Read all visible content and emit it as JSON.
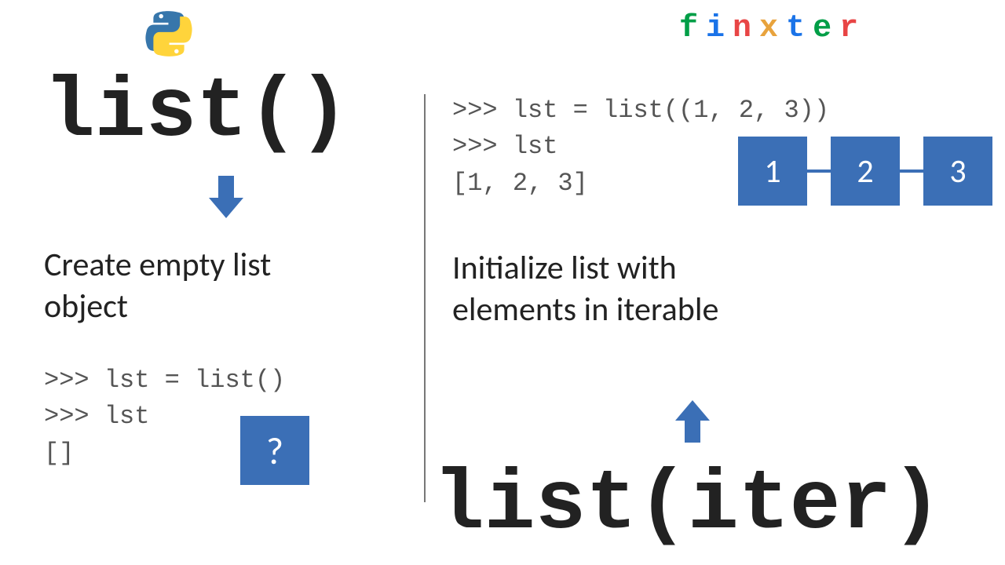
{
  "left": {
    "title": "list()",
    "desc": "Create empty list\nobject",
    "code": ">>> lst = list()\n>>> lst\n[]",
    "qmark": "?"
  },
  "right": {
    "title": "list(iter)",
    "desc": "Initialize list with\nelements in iterable",
    "code": ">>> lst = list((1, 2, 3))\n>>> lst\n[1, 2, 3]",
    "nodes": [
      "1",
      "2",
      "3"
    ]
  },
  "brand": {
    "letters": [
      "f",
      "i",
      "n",
      "x",
      "t",
      "e",
      "r"
    ]
  }
}
